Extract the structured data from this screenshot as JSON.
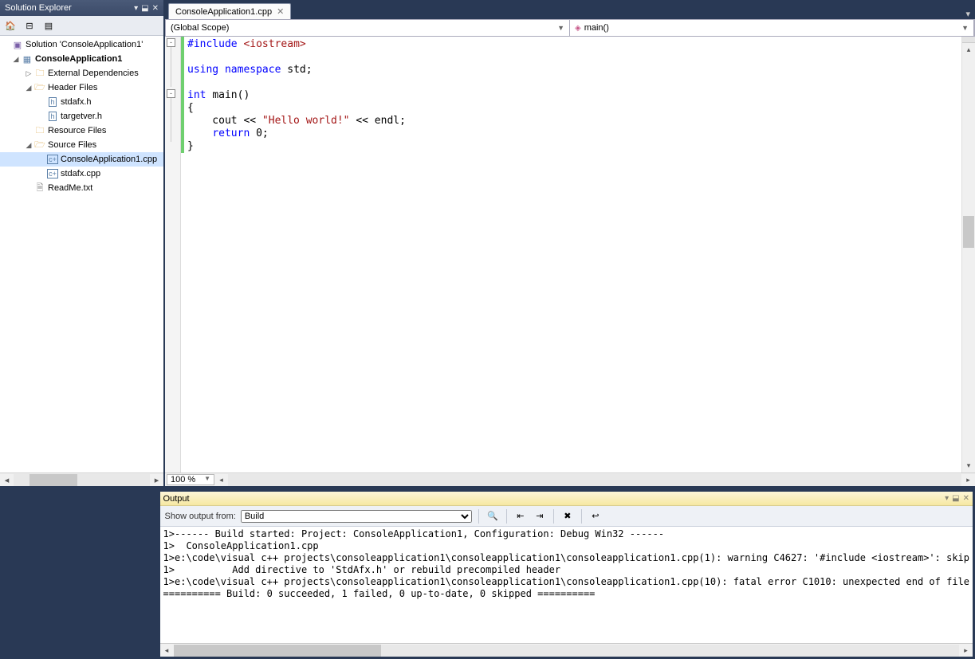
{
  "solutionExplorer": {
    "title": "Solution Explorer",
    "tree": {
      "solution": "Solution 'ConsoleApplication1'",
      "project": "ConsoleApplication1",
      "externalDeps": "External Dependencies",
      "headerFiles": "Header Files",
      "stdafx_h": "stdafx.h",
      "targetver_h": "targetver.h",
      "resourceFiles": "Resource Files",
      "sourceFiles": "Source Files",
      "consoleApp_cpp": "ConsoleApplication1.cpp",
      "stdafx_cpp": "stdafx.cpp",
      "readme": "ReadMe.txt"
    }
  },
  "editor": {
    "tab": "ConsoleApplication1.cpp",
    "scopeLeft": "(Global Scope)",
    "scopeRight": "main()",
    "zoom": "100 %",
    "code": {
      "l1a": "#include ",
      "l1b": "<iostream>",
      "l2": "",
      "l3a": "using ",
      "l3b": "namespace ",
      "l3c": "std;",
      "l4": "",
      "l5a": "int ",
      "l5b": "main()",
      "l6": "{",
      "l7a": "    cout << ",
      "l7b": "\"Hello world!\"",
      "l7c": " << endl;",
      "l8a": "    ",
      "l8b": "return ",
      "l8c": "0;",
      "l9": "}"
    }
  },
  "output": {
    "title": "Output",
    "showFromLabel": "Show output from:",
    "showFromValue": "Build",
    "lines": [
      "1>------ Build started: Project: ConsoleApplication1, Configuration: Debug Win32 ------",
      "1>  ConsoleApplication1.cpp",
      "1>e:\\code\\visual c++ projects\\consoleapplication1\\consoleapplication1\\consoleapplication1.cpp(1): warning C4627: '#include <iostream>': skip",
      "1>          Add directive to 'StdAfx.h' or rebuild precompiled header",
      "1>e:\\code\\visual c++ projects\\consoleapplication1\\consoleapplication1\\consoleapplication1.cpp(10): fatal error C1010: unexpected end of file",
      "========== Build: 0 succeeded, 1 failed, 0 up-to-date, 0 skipped =========="
    ]
  }
}
